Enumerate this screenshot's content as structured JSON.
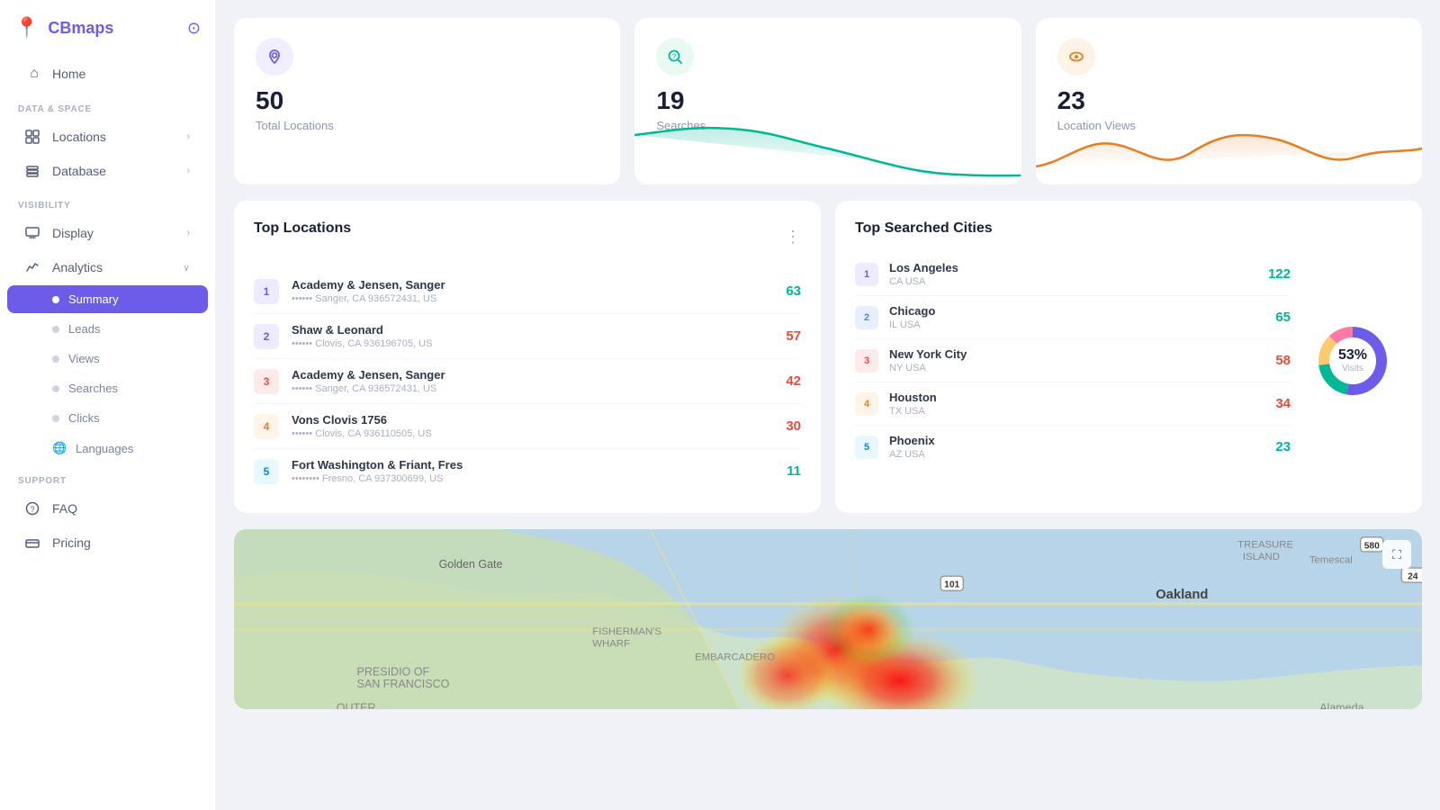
{
  "app": {
    "name": "CBmaps",
    "settings_icon": "⊙"
  },
  "sidebar": {
    "sections": [
      {
        "label": "",
        "items": [
          {
            "id": "home",
            "label": "Home",
            "icon": "⌂",
            "hasChevron": false,
            "active": false
          }
        ]
      },
      {
        "label": "DATA & SPACE",
        "items": [
          {
            "id": "locations",
            "label": "Locations",
            "icon": "⊞",
            "hasChevron": true,
            "active": false
          },
          {
            "id": "database",
            "label": "Database",
            "icon": "⊟",
            "hasChevron": true,
            "active": false
          }
        ]
      },
      {
        "label": "VISIBILITY",
        "items": [
          {
            "id": "display",
            "label": "Display",
            "icon": "▭",
            "hasChevron": true,
            "active": false
          },
          {
            "id": "analytics",
            "label": "Analytics",
            "icon": "∿",
            "hasChevron": true,
            "active": false,
            "expanded": true
          }
        ]
      }
    ],
    "analytics_sub": [
      {
        "id": "summary",
        "label": "Summary",
        "active": true
      },
      {
        "id": "leads",
        "label": "Leads",
        "active": false
      },
      {
        "id": "views",
        "label": "Views",
        "active": false
      },
      {
        "id": "searches",
        "label": "Searches",
        "active": false
      },
      {
        "id": "clicks",
        "label": "Clicks",
        "active": false
      },
      {
        "id": "languages",
        "label": "Languages",
        "active": false,
        "icon": "globe"
      }
    ],
    "support": {
      "label": "SUPPORT",
      "items": [
        {
          "id": "faq",
          "label": "FAQ",
          "icon": "?",
          "active": false
        },
        {
          "id": "pricing",
          "label": "Pricing",
          "icon": "▬",
          "active": false
        }
      ]
    }
  },
  "stats": [
    {
      "id": "total-locations",
      "icon": "📍",
      "icon_type": "purple",
      "number": "50",
      "label": "Total Locations",
      "chart_color": "#6c5ce7",
      "chart_type": "none"
    },
    {
      "id": "searches",
      "icon": "?",
      "icon_type": "green",
      "number": "19",
      "label": "Searches",
      "chart_color": "#00b894",
      "chart_type": "line"
    },
    {
      "id": "location-views",
      "icon": "👁",
      "icon_type": "orange",
      "number": "23",
      "label": "Location Views",
      "chart_color": "#e67e22",
      "chart_type": "line_orange"
    }
  ],
  "top_locations": {
    "title": "Top Locations",
    "items": [
      {
        "rank": 1,
        "name": "Academy & Jensen, Sanger",
        "addr": "•••••• Sanger, CA 936572431, US",
        "count": "63",
        "count_class": "count-green"
      },
      {
        "rank": 2,
        "name": "Shaw & Leonard",
        "addr": "•••••• Clovis, CA 936196705, US",
        "count": "57",
        "count_class": "count-red"
      },
      {
        "rank": 3,
        "name": "Academy & Jensen, Sanger",
        "addr": "•••••• Sanger, CA 936572431, US",
        "count": "42",
        "count_class": "count-red"
      },
      {
        "rank": 4,
        "name": "Vons Clovis 1756",
        "addr": "•••••• Clovis, CA 936110505, US",
        "count": "30",
        "count_class": "count-red"
      },
      {
        "rank": 5,
        "name": "Fort Washington & Friant, Fres",
        "addr": "•••••••• Fresno, CA 937300699, US",
        "count": "11",
        "count_class": "count-green"
      }
    ]
  },
  "top_cities": {
    "title": "Top Searched Cities",
    "donut": {
      "percent": "53%",
      "label": "Visits",
      "segments": [
        {
          "color": "#6c5ce7",
          "value": 53
        },
        {
          "color": "#00b894",
          "value": 20
        },
        {
          "color": "#fdcb6e",
          "value": 15
        },
        {
          "color": "#fd79a8",
          "value": 12
        }
      ]
    },
    "items": [
      {
        "rank": 1,
        "name": "Los Angeles",
        "region": "CA USA",
        "count": "122",
        "count_class": "count-green",
        "badge_bg": "#eeeaff",
        "badge_color": "#6c5ce7"
      },
      {
        "rank": 2,
        "name": "Chicago",
        "region": "IL USA",
        "count": "65",
        "count_class": "count-green",
        "badge_bg": "#e8f0ff",
        "badge_color": "#5a7df5"
      },
      {
        "rank": 3,
        "name": "New York City",
        "region": "NY USA",
        "count": "58",
        "count_class": "count-red",
        "badge_bg": "#ffeaea",
        "badge_color": "#e74c3c"
      },
      {
        "rank": 4,
        "name": "Houston",
        "region": "TX USA",
        "count": "34",
        "count_class": "count-red",
        "badge_bg": "#fff4e8",
        "badge_color": "#e67e22"
      },
      {
        "rank": 5,
        "name": "Phoenix",
        "region": "AZ USA",
        "count": "23",
        "count_class": "count-green",
        "badge_bg": "#e8f8ff",
        "badge_color": "#0984e3"
      }
    ]
  },
  "map": {
    "expand_icon": "⛶"
  }
}
